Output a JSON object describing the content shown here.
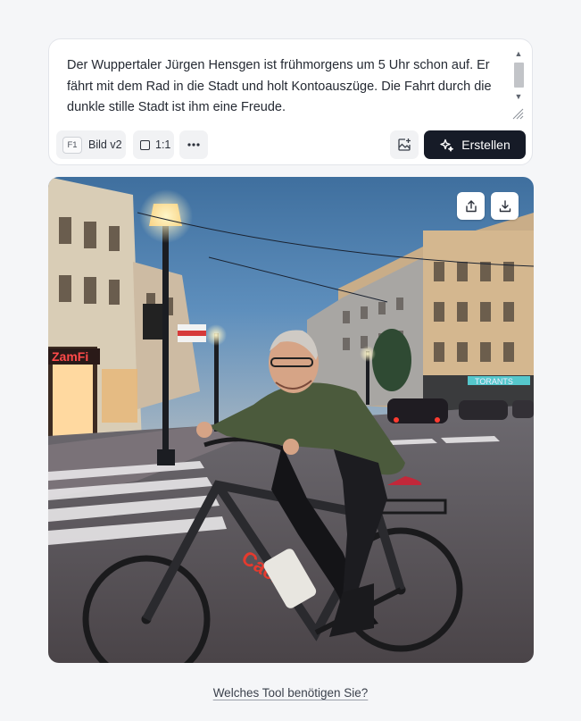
{
  "prompt": {
    "text": "Der Wuppertaler Jürgen Hensgen ist frühmorgens um 5 Uhr schon auf. Er fährt mit dem Rad in die Stadt und holt Kontoauszüge. Die Fahrt durch die dunkle stille Stadt ist ihm eine Freude."
  },
  "toolbar": {
    "model_badge": "F1",
    "model_label": "Bild v2",
    "ratio_label": "1:1",
    "more_icon": "more-horizontal-icon",
    "image_icon": "image-plus-icon",
    "create_label": "Erstellen",
    "create_icon": "sparkles-icon"
  },
  "image": {
    "subject": "generated-image",
    "sign_left": "ZamFi",
    "sign_right": "TORANTS",
    "bike_frame_text": "Cacker",
    "share_icon": "share-icon",
    "download_icon": "download-icon"
  },
  "footer": {
    "link_label": "Welches Tool benötigen Sie?"
  },
  "colors": {
    "primary_button": "#161b27",
    "background": "#f5f6f8"
  }
}
